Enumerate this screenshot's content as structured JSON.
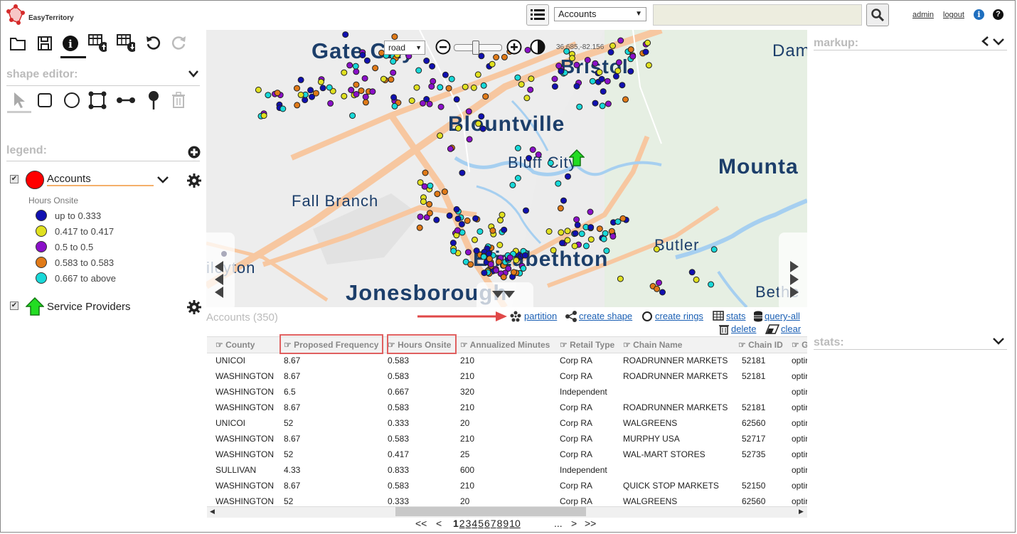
{
  "app": {
    "logo_text": "EasyTerritory"
  },
  "header": {
    "layer_select": "Accounts",
    "search_placeholder": "",
    "admin_link": "admin",
    "logout_link": "logout",
    "info_icon": "i",
    "help_icon": "?"
  },
  "map": {
    "basemap_select": "road",
    "coords": "36.685,-82.156",
    "labels": [
      "Gate City",
      "Bristol",
      "Blountville",
      "Bluff City",
      "Mounta",
      "Fall Branch",
      "Butler",
      "Elizabethton",
      "ilcyton",
      "Jonesborough",
      "Dam",
      "Bethe"
    ]
  },
  "left": {
    "shape_editor": "shape editor:",
    "legend": "legend:",
    "layers": [
      {
        "name": "Accounts",
        "color": "#ff0000"
      },
      {
        "name": "Service Providers",
        "color": "#22dd22"
      }
    ],
    "classification_title": "Hours Onsite",
    "classes": [
      {
        "label": "up to 0.333",
        "color": "#1010b0"
      },
      {
        "label": "0.417 to 0.417",
        "color": "#e0e020"
      },
      {
        "label": "0.5 to 0.5",
        "color": "#8a10c8"
      },
      {
        "label": "0.583 to 0.583",
        "color": "#e07a18"
      },
      {
        "label": "0.667 to above",
        "color": "#18d8d8"
      }
    ]
  },
  "table": {
    "title": "Accounts (350)",
    "actions": {
      "partition": "partition",
      "create_shape": "create shape",
      "create_rings": "create rings",
      "stats": "stats",
      "query_all": "query-all",
      "delete": "delete",
      "clear": "clear"
    },
    "columns": [
      "County",
      "Proposed Frequency",
      "Hours Onsite",
      "Annualized Minutes",
      "Retail Type",
      "Chain Name",
      "Chain ID",
      "G"
    ],
    "rows": [
      [
        "UNICOI",
        "8.67",
        "0.583",
        "210",
        "Corp RA",
        "ROADRUNNER MARKETS",
        "52181",
        "optir"
      ],
      [
        "WASHINGTON",
        "8.67",
        "0.583",
        "210",
        "Corp RA",
        "ROADRUNNER MARKETS",
        "52181",
        "optir"
      ],
      [
        "WASHINGTON",
        "6.5",
        "0.667",
        "320",
        "Independent",
        "",
        "",
        "optir"
      ],
      [
        "WASHINGTON",
        "8.67",
        "0.583",
        "210",
        "Corp RA",
        "ROADRUNNER MARKETS",
        "52181",
        "optir"
      ],
      [
        "UNICOI",
        "52",
        "0.333",
        "20",
        "Corp RA",
        "WALGREENS",
        "62560",
        "optir"
      ],
      [
        "WASHINGTON",
        "8.67",
        "0.583",
        "210",
        "Corp RA",
        "MURPHY USA",
        "52717",
        "optir"
      ],
      [
        "WASHINGTON",
        "52",
        "0.417",
        "25",
        "Corp RA",
        "WAL-MART STORES",
        "52735",
        "optir"
      ],
      [
        "SULLIVAN",
        "4.33",
        "0.833",
        "600",
        "Independent",
        "",
        "",
        "optir"
      ],
      [
        "WASHINGTON",
        "8.67",
        "0.583",
        "210",
        "Corp RA",
        "QUICK STOP MARKETS",
        "52150",
        "optir"
      ],
      [
        "WASHINGTON",
        "52",
        "0.333",
        "20",
        "Corp RA",
        "WALGREENS",
        "62560",
        "optir"
      ]
    ],
    "pager": {
      "first": "<<",
      "prev": "<",
      "pages": [
        "1",
        "2",
        "3",
        "4",
        "5",
        "6",
        "7",
        "8",
        "9",
        "10"
      ],
      "ellipsis": "...",
      "next": ">",
      "last": ">>"
    }
  },
  "right": {
    "markup": "markup:",
    "stats": "stats:"
  }
}
